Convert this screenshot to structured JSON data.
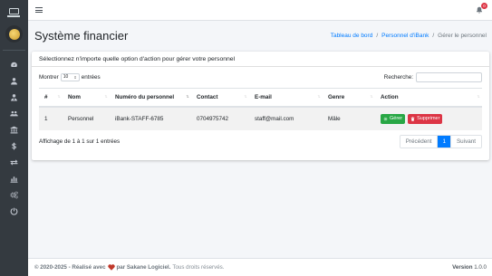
{
  "colors": {
    "sidebar_bg": "#343a40",
    "primary": "#007bff",
    "success": "#28a745",
    "danger": "#dc3545",
    "page_bg": "#f4f6f9"
  },
  "sidebar": {
    "items": [
      {
        "icon": "tachometer-icon"
      },
      {
        "icon": "user-icon"
      },
      {
        "icon": "user-tie-icon"
      },
      {
        "icon": "users-icon"
      },
      {
        "icon": "bank-icon"
      },
      {
        "icon": "dollar-icon"
      },
      {
        "icon": "exchange-icon"
      },
      {
        "icon": "chart-bar-icon"
      },
      {
        "icon": "cogs-icon"
      },
      {
        "icon": "power-off-icon"
      }
    ]
  },
  "topbar": {
    "notification_count": "0"
  },
  "header": {
    "title": "Système financier",
    "breadcrumb": [
      "Tableau de bord",
      "Personnel d'iBank",
      "Gérer le personnel"
    ]
  },
  "card": {
    "header_text": "Sélectionnez n'importe quelle option d'action pour gérer votre personnel"
  },
  "table_controls": {
    "show_label": "Montrer",
    "show_value": "10",
    "entries_label": "entrées",
    "search_label": "Recherche:",
    "search_value": ""
  },
  "table": {
    "columns": [
      "#",
      "Nom",
      "Numéro du personnel",
      "Contact",
      "E-mail",
      "Genre",
      "Action"
    ],
    "rows": [
      {
        "index": "1",
        "name": "Personnel",
        "staff_number": "iBank-STAFF-6785",
        "contact": "0704975742",
        "email": "staff@mail.com",
        "gender": "Mâle",
        "manage_label": "Gérer",
        "delete_label": "Supprimer"
      }
    ]
  },
  "pagination": {
    "info": "Affichage de 1 à 1 sur 1 entrées",
    "previous": "Précédent",
    "current_page": "1",
    "next": "Suivant"
  },
  "footer": {
    "copyright": "© 2020-2025 - Réalisé avec",
    "by": "par Sakane Logiciel.",
    "rights": "Tous droits réservés.",
    "version_label": "Version",
    "version_value": "1.0.0"
  }
}
